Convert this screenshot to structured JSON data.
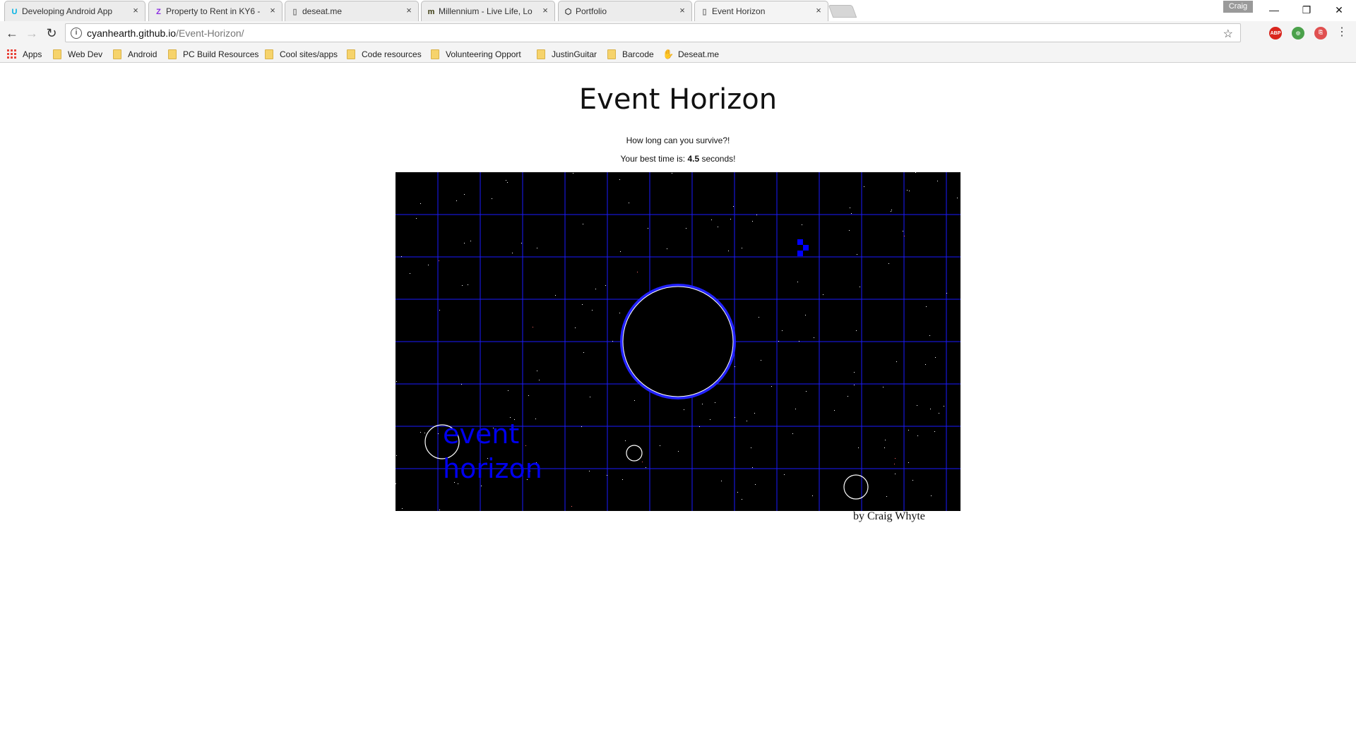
{
  "browser": {
    "tabs": [
      {
        "label": "Developing Android App",
        "favicon": "udacity-icon",
        "favicon_glyph": "U",
        "favicon_color": "#02b3e4"
      },
      {
        "label": "Property to Rent in KY6 -",
        "favicon": "zoopla-icon",
        "favicon_glyph": "Z",
        "favicon_color": "#8a2be2"
      },
      {
        "label": "deseat.me",
        "favicon": "page-icon",
        "favicon_glyph": "▯",
        "favicon_color": "#777777"
      },
      {
        "label": "Millennium - Live Life, Lo",
        "favicon": "millennium-icon",
        "favicon_glyph": "m",
        "favicon_color": "#3a3a10"
      },
      {
        "label": "Portfolio",
        "favicon": "codepen-icon",
        "favicon_glyph": "⬡",
        "favicon_color": "#333333"
      },
      {
        "label": "Event Horizon",
        "favicon": "page-icon",
        "favicon_glyph": "▯",
        "favicon_color": "#777777",
        "active": true
      }
    ],
    "profile_name": "Craig",
    "address": {
      "host": "cyanhearth.github.io",
      "path": "/Event-Horizon/"
    },
    "bookmarks": [
      {
        "label": "Apps",
        "icon": "apps-grid-icon"
      },
      {
        "label": "Web Dev",
        "icon": "folder-icon"
      },
      {
        "label": "Android",
        "icon": "folder-icon"
      },
      {
        "label": "PC Build Resources",
        "icon": "folder-icon"
      },
      {
        "label": "Cool sites/apps",
        "icon": "folder-icon"
      },
      {
        "label": "Code resources",
        "icon": "folder-icon"
      },
      {
        "label": "Volunteering Opport",
        "icon": "folder-icon"
      },
      {
        "label": "JustinGuitar",
        "icon": "folder-icon"
      },
      {
        "label": "Barcode",
        "icon": "folder-icon"
      },
      {
        "label": "Deseat.me",
        "icon": "hand-icon"
      }
    ],
    "extensions": [
      {
        "name": "adblock-plus-icon",
        "glyph": "ABP",
        "color": "#d9251d"
      },
      {
        "name": "chrome-extension-icon",
        "glyph": "◎",
        "color": "#4aa14a"
      },
      {
        "name": "pdf-extension-icon",
        "glyph": "⎘",
        "color": "#e05050"
      }
    ]
  },
  "page": {
    "title": "Event Horizon",
    "tagline": "How long can you survive?!",
    "best_prefix": "Your best time is: ",
    "best_time": "4.5",
    "best_suffix": " seconds!",
    "game_text_line1": "event",
    "game_text_line2": "horizon",
    "credit": "by Craig Whyte"
  },
  "colors": {
    "game_background": "#000000",
    "grid": "#1a1aff",
    "ring": "#2222ff",
    "player": "#0000ff",
    "text_blue": "#0000ee"
  }
}
